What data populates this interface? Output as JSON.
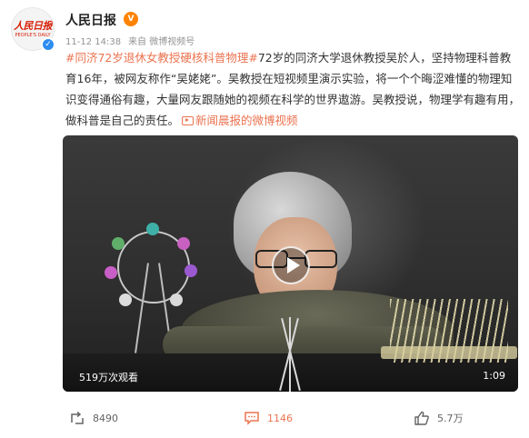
{
  "account": {
    "name": "人民日报",
    "avatar_text": "人民日报",
    "avatar_subtext": "PEOPLE'S DAILY",
    "verified_mark": "✓",
    "badge_mark": "V"
  },
  "meta": {
    "time": "11-12 14:38",
    "source": "来自 微博视频号"
  },
  "post": {
    "hashtag": "#同济72岁退休女教授硬核科普物理#",
    "body": "72岁的同济大学退休教授吴於人，坚持物理科普教育16年，被网友称作“吴姥姥”。吴教授在短视频里演示实验，将一个个晦涩难懂的物理知识变得通俗有趣，大量网友跟随她的视频在科学的世界遨游。吴教授说，物理学有趣有用，做科普是自己的责任。",
    "source_link": "新闻晨报的微博视频"
  },
  "video": {
    "view_count": "519万次观看",
    "duration": "1:09"
  },
  "actions": {
    "repost_count": "8490",
    "comment_count": "1146",
    "like_count": "5.7万"
  },
  "colors": {
    "accent": "#eb7350",
    "verified": "#2d8cf0",
    "badge": "#ff8200",
    "logo_red": "#d81e06"
  },
  "icons": [
    "verified-icon",
    "badge-icon",
    "video-link-icon",
    "play-icon",
    "repost-icon",
    "comment-icon",
    "like-icon"
  ]
}
